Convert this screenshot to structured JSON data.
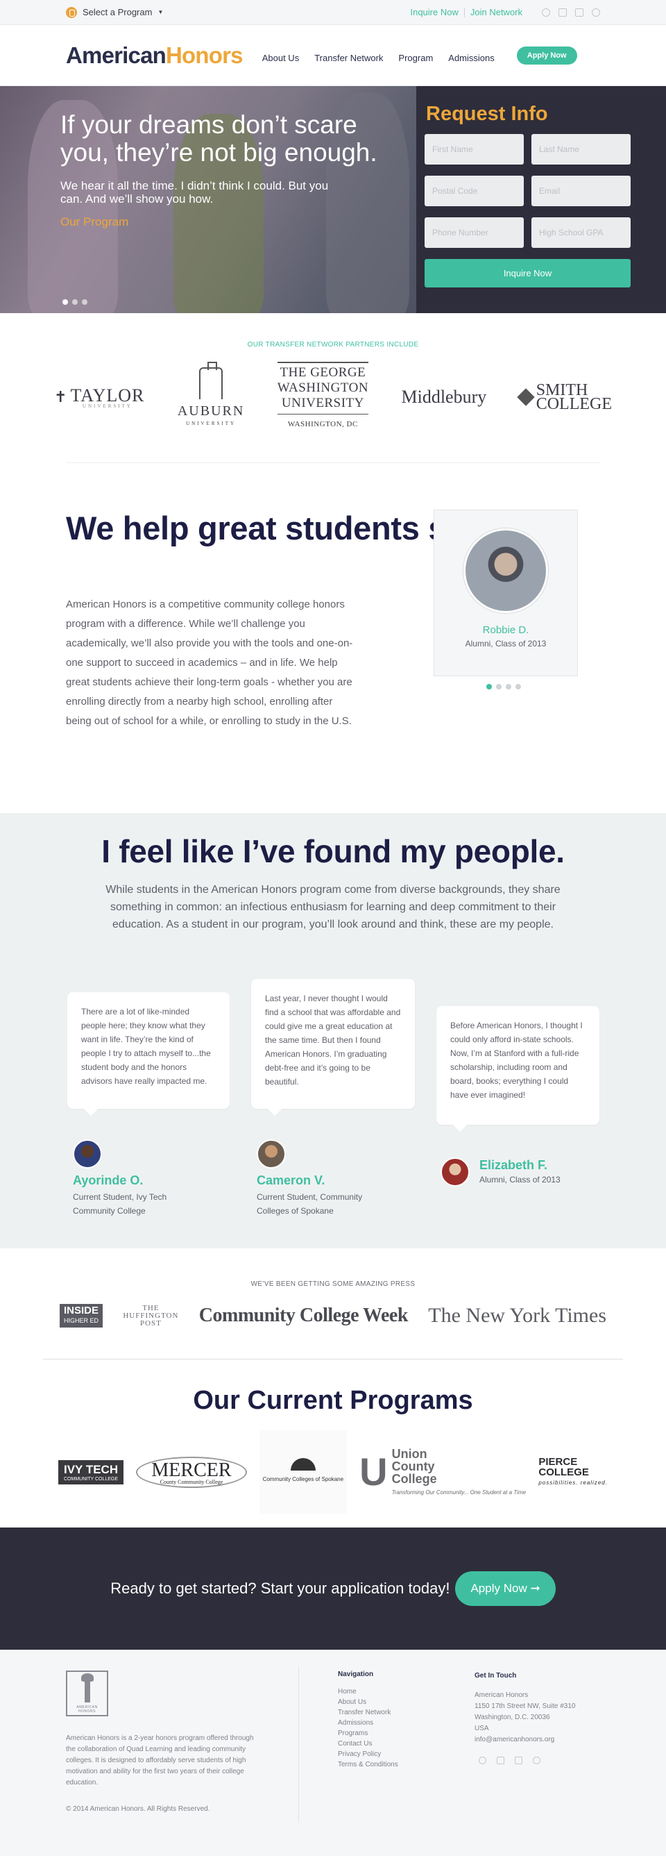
{
  "topbar": {
    "program_select": "Select a Program",
    "inquire": "Inquire Now",
    "join": "Join Network"
  },
  "nav": {
    "logo_a": "American",
    "logo_b": "Honors",
    "links": [
      "About Us",
      "Transfer Network",
      "Program",
      "Admissions"
    ],
    "apply": "Apply Now"
  },
  "hero": {
    "headline": "If your dreams don’t scare you, they’re not big enough.",
    "subtext": "We hear it all the time. I didn’t think I could. But you can. And we’ll show you how.",
    "link": "Our Program"
  },
  "form": {
    "title": "Request Info",
    "fields": {
      "first_name": "First Name",
      "last_name": "Last Name",
      "postal_code": "Postal Code",
      "email": "Email",
      "phone": "Phone Number",
      "gpa": "High School GPA"
    },
    "submit": "Inquire Now"
  },
  "partners": {
    "label": "OUR TRANSFER NETWORK PARTNERS INCLUDE",
    "taylor": "TAYLOR",
    "taylor_sub": "UNIVERSITY",
    "auburn": "AUBURN",
    "auburn_sub": "UNIVERSITY",
    "gwu_1": "THE GEORGE",
    "gwu_2": "WASHINGTON",
    "gwu_3": "UNIVERSITY",
    "gwu_4": "WASHINGTON, DC",
    "middlebury": "Middlebury",
    "smith_1": "SMITH",
    "smith_2": "COLLEGE"
  },
  "succeed": {
    "heading": "We help great students succeed.",
    "body": "American Honors is a competitive community college honors program with a difference. While we’ll challenge you academically, we’ll also provide you with the tools and one-on-one support to succeed in academics – and in life. We help great students achieve their long-term goals - whether you are enrolling directly from a nearby high school, enrolling after being out of school for a while, or enrolling to study in the U.S.",
    "student_name": "Robbie D.",
    "student_role": "Alumni, Class of 2013"
  },
  "people": {
    "heading": "I feel like I’ve found my people.",
    "intro": "While students in the American Honors program come from diverse backgrounds, they share something in common: an infectious enthusiasm for learning and deep commitment to their education. As a student in our program, you’ll look around and think, these are my people.",
    "testimonials": [
      {
        "quote": "There are a lot of like-minded people here; they know what they want in life. They’re the kind of people I try to attach myself to...the student body and the honors advisors have really impacted me.",
        "name": "Ayorinde O.",
        "role": "Current Student, Ivy Tech Community College"
      },
      {
        "quote": "Last year, I never thought I would find a school that was affordable and could give me a great education at the same time. But then I found American Honors. I’m graduating debt-free and it’s going to be beautiful.",
        "name": "Cameron V.",
        "role": "Current Student, Community Colleges of Spokane"
      },
      {
        "quote": "Before American Honors, I thought I could only afford in-state schools. Now, I’m at Stanford with a full-ride scholarship, including room and board, books; everything I could have ever imagined!",
        "name": "Elizabeth F.",
        "role": "Alumni, Class of 2013"
      }
    ]
  },
  "press": {
    "label": "WE’VE BEEN GETTING SOME AMAZING PRESS",
    "inside_1": "INSIDE",
    "inside_2": "HIGHER ED",
    "huff_1": "THE",
    "huff_2": "HUFFINGTON",
    "huff_3": "POST",
    "ccw": "Community College Week",
    "nyt": "The New York Times"
  },
  "programs": {
    "heading": "Our Current Programs",
    "ivy_1": "IVY TECH",
    "ivy_2": "COMMUNITY COLLEGE",
    "mercer_1": "MERCER",
    "mercer_2": "County Community College",
    "ccs": "Community Colleges of Spokane",
    "union_u": "U",
    "union_1": "Union",
    "union_2": "County",
    "union_3": "College",
    "union_tag": "Transforming Our Community... One Student at a Time",
    "pierce_1": "PIERCE",
    "pierce_2": "COLLEGE",
    "pierce_tag": "possibilities. realized."
  },
  "cta": {
    "text": "Ready to get started? Start your application today!",
    "button": "Apply Now ➞"
  },
  "footer": {
    "logo_text": "AMERICAN HONORS",
    "about": "American Honors is a 2-year honors program offered through the collaboration of Quad Learning and leading community colleges. It is designed to affordably serve students of high motivation and ability for the first two years of their college education.",
    "copyright": "© 2014 American Honors. All Rights Reserved.",
    "nav_title": "Navigation",
    "nav_links": [
      "Home",
      "About Us",
      "Transfer Network",
      "Admissions",
      "Programs",
      "Contact Us",
      "Privacy Policy",
      "Terms & Conditions"
    ],
    "contact_title": "Get In Touch",
    "contact_lines": [
      "American Honors",
      "1150 17th Street NW, Suite #310",
      "Washington, D.C. 20036",
      "USA",
      "info@americanhonors.org"
    ]
  }
}
